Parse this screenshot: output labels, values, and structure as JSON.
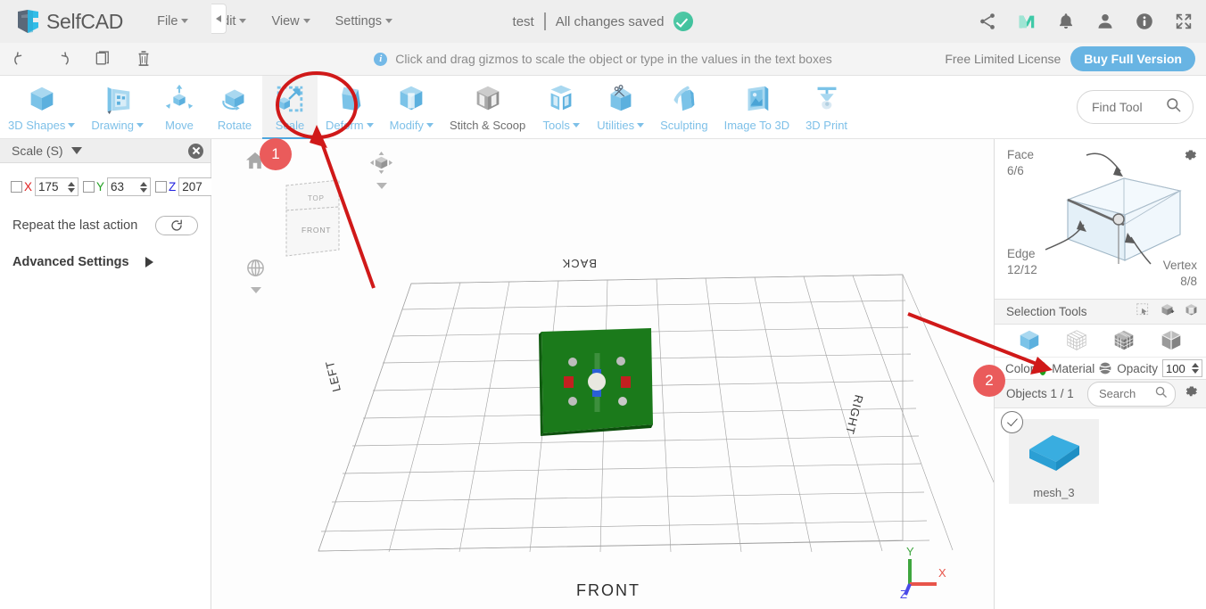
{
  "app": {
    "brand": "SelfCAD",
    "logo_icon": "selfcad-logo-icon"
  },
  "header": {
    "menus": [
      {
        "label": "File",
        "name": "menu-file"
      },
      {
        "label": "Edit",
        "name": "menu-edit"
      },
      {
        "label": "View",
        "name": "menu-view"
      },
      {
        "label": "Settings",
        "name": "menu-settings"
      }
    ],
    "document_title": "test",
    "save_status": "All changes saved",
    "save_status_icon": "check-circle-icon",
    "icons": [
      {
        "name": "share-icon",
        "label": "Share"
      },
      {
        "name": "myminifactory-m-icon",
        "label": "M"
      },
      {
        "name": "bell-icon",
        "label": "Notifications"
      },
      {
        "name": "user-icon",
        "label": "Account"
      },
      {
        "name": "info-circle-icon",
        "label": "Info"
      },
      {
        "name": "fullscreen-icon",
        "label": "Fullscreen"
      }
    ]
  },
  "subbar": {
    "buttons": [
      {
        "name": "undo-icon",
        "label": "Undo"
      },
      {
        "name": "redo-icon",
        "label": "Redo"
      },
      {
        "name": "copy-icon",
        "label": "Copy"
      },
      {
        "name": "delete-icon",
        "label": "Delete"
      }
    ],
    "hint": "Click and drag gizmos to scale the object or type in the values in the text boxes",
    "hint_icon": "info-icon",
    "license_label": "Free Limited License",
    "buy_button": "Buy Full Version"
  },
  "toolbar": {
    "tools": [
      {
        "label": "3D Shapes",
        "icon": "cube-icon",
        "dropdown": true,
        "active": false,
        "disabled": false
      },
      {
        "label": "Drawing",
        "icon": "drawing-icon",
        "dropdown": true,
        "active": false,
        "disabled": false
      },
      {
        "label": "Move",
        "icon": "move-icon",
        "dropdown": false,
        "active": false,
        "disabled": false
      },
      {
        "label": "Rotate",
        "icon": "rotate-icon",
        "dropdown": false,
        "active": false,
        "disabled": false
      },
      {
        "label": "Scale",
        "icon": "scale-icon",
        "dropdown": false,
        "active": true,
        "disabled": false
      },
      {
        "label": "Deform",
        "icon": "deform-icon",
        "dropdown": true,
        "active": false,
        "disabled": false
      },
      {
        "label": "Modify",
        "icon": "modify-icon",
        "dropdown": true,
        "active": false,
        "disabled": false
      },
      {
        "label": "Stitch & Scoop",
        "icon": "stitch-scoop-icon",
        "dropdown": false,
        "active": false,
        "disabled": true
      },
      {
        "label": "Tools",
        "icon": "tools-icon",
        "dropdown": true,
        "active": false,
        "disabled": false
      },
      {
        "label": "Utilities",
        "icon": "utilities-icon",
        "dropdown": true,
        "active": false,
        "disabled": false
      },
      {
        "label": "Sculpting",
        "icon": "sculpting-icon",
        "dropdown": false,
        "active": false,
        "disabled": false
      },
      {
        "label": "Image To 3D",
        "icon": "image-to-3d-icon",
        "dropdown": false,
        "active": false,
        "disabled": false
      },
      {
        "label": "3D Print",
        "icon": "3d-print-icon",
        "dropdown": false,
        "active": false,
        "disabled": false
      }
    ],
    "find_tool_placeholder": "Find Tool",
    "find_tool_value": "",
    "find_tool_icon": "search-icon"
  },
  "left_panel": {
    "title": "Scale (S)",
    "close_icon": "close-circle-icon",
    "collapse_icon": "chevron-left-icon",
    "axes": [
      {
        "axis": "X",
        "value": "175",
        "checked": false,
        "color": "#e02020"
      },
      {
        "axis": "Y",
        "value": "63",
        "checked": false,
        "color": "#22a122"
      },
      {
        "axis": "Z",
        "value": "207",
        "checked": false,
        "color": "#2020e0"
      }
    ],
    "repeat_label": "Repeat the last action",
    "repeat_icon": "refresh-icon",
    "advanced_label": "Advanced Settings",
    "advanced_caret": "chevron-right-icon"
  },
  "viewport": {
    "nav_home_icon": "home-icon",
    "nav_cube_icon": "view-cube-icon",
    "nav_orbit_icon": "orbit-icon",
    "nav_cube_faces": [
      "TOP",
      "FRONT"
    ],
    "ground_labels": {
      "back": "BACK",
      "left": "LEFT",
      "right": "RIGHT",
      "front": "FRONT"
    },
    "object_color": "#1b7a1b",
    "axis_gizmo": {
      "x": "X",
      "y": "Y",
      "z": "Z",
      "x_color": "#e8544a",
      "y_color": "#3fa63f",
      "z_color": "#4a4ae8"
    }
  },
  "right_panel": {
    "mesh_info": {
      "face_label": "Face",
      "face_value": "6/6",
      "edge_label": "Edge",
      "edge_value": "12/12",
      "vertex_label": "Vertex",
      "vertex_value": "8/8",
      "gear_icon": "gear-icon",
      "diagram_icon": "wireframe-box-icon"
    },
    "selection_tools": {
      "label": "Selection Tools",
      "icons": [
        {
          "name": "rectangle-select-icon"
        },
        {
          "name": "box-select-add-icon"
        },
        {
          "name": "box-select-through-icon"
        }
      ],
      "modes": [
        {
          "name": "object-mode-icon",
          "active": true
        },
        {
          "name": "vertex-mode-icon",
          "active": false
        },
        {
          "name": "face-mode-icon",
          "active": false
        },
        {
          "name": "edge-mode-icon",
          "active": false
        }
      ]
    },
    "appearance": {
      "color_label": "Color",
      "color_value": "#1fa21f",
      "material_label": "Material",
      "material_icon": "material-sphere-icon",
      "opacity_label": "Opacity",
      "opacity_value": "100"
    },
    "objects": {
      "count_label": "Objects 1 / 1",
      "search_placeholder": "Search",
      "search_value": "",
      "search_icon": "search-icon",
      "gear_icon": "gear-icon",
      "items": [
        {
          "name": "mesh_3",
          "selected": true,
          "thumb_color": "#39ade0"
        }
      ]
    }
  },
  "annotations": {
    "badges": [
      {
        "number": "1",
        "target": "scale-tool"
      },
      {
        "number": "2",
        "target": "color-swatch"
      }
    ],
    "highlight_color": "#d01919",
    "arrow_color": "#d01919"
  }
}
